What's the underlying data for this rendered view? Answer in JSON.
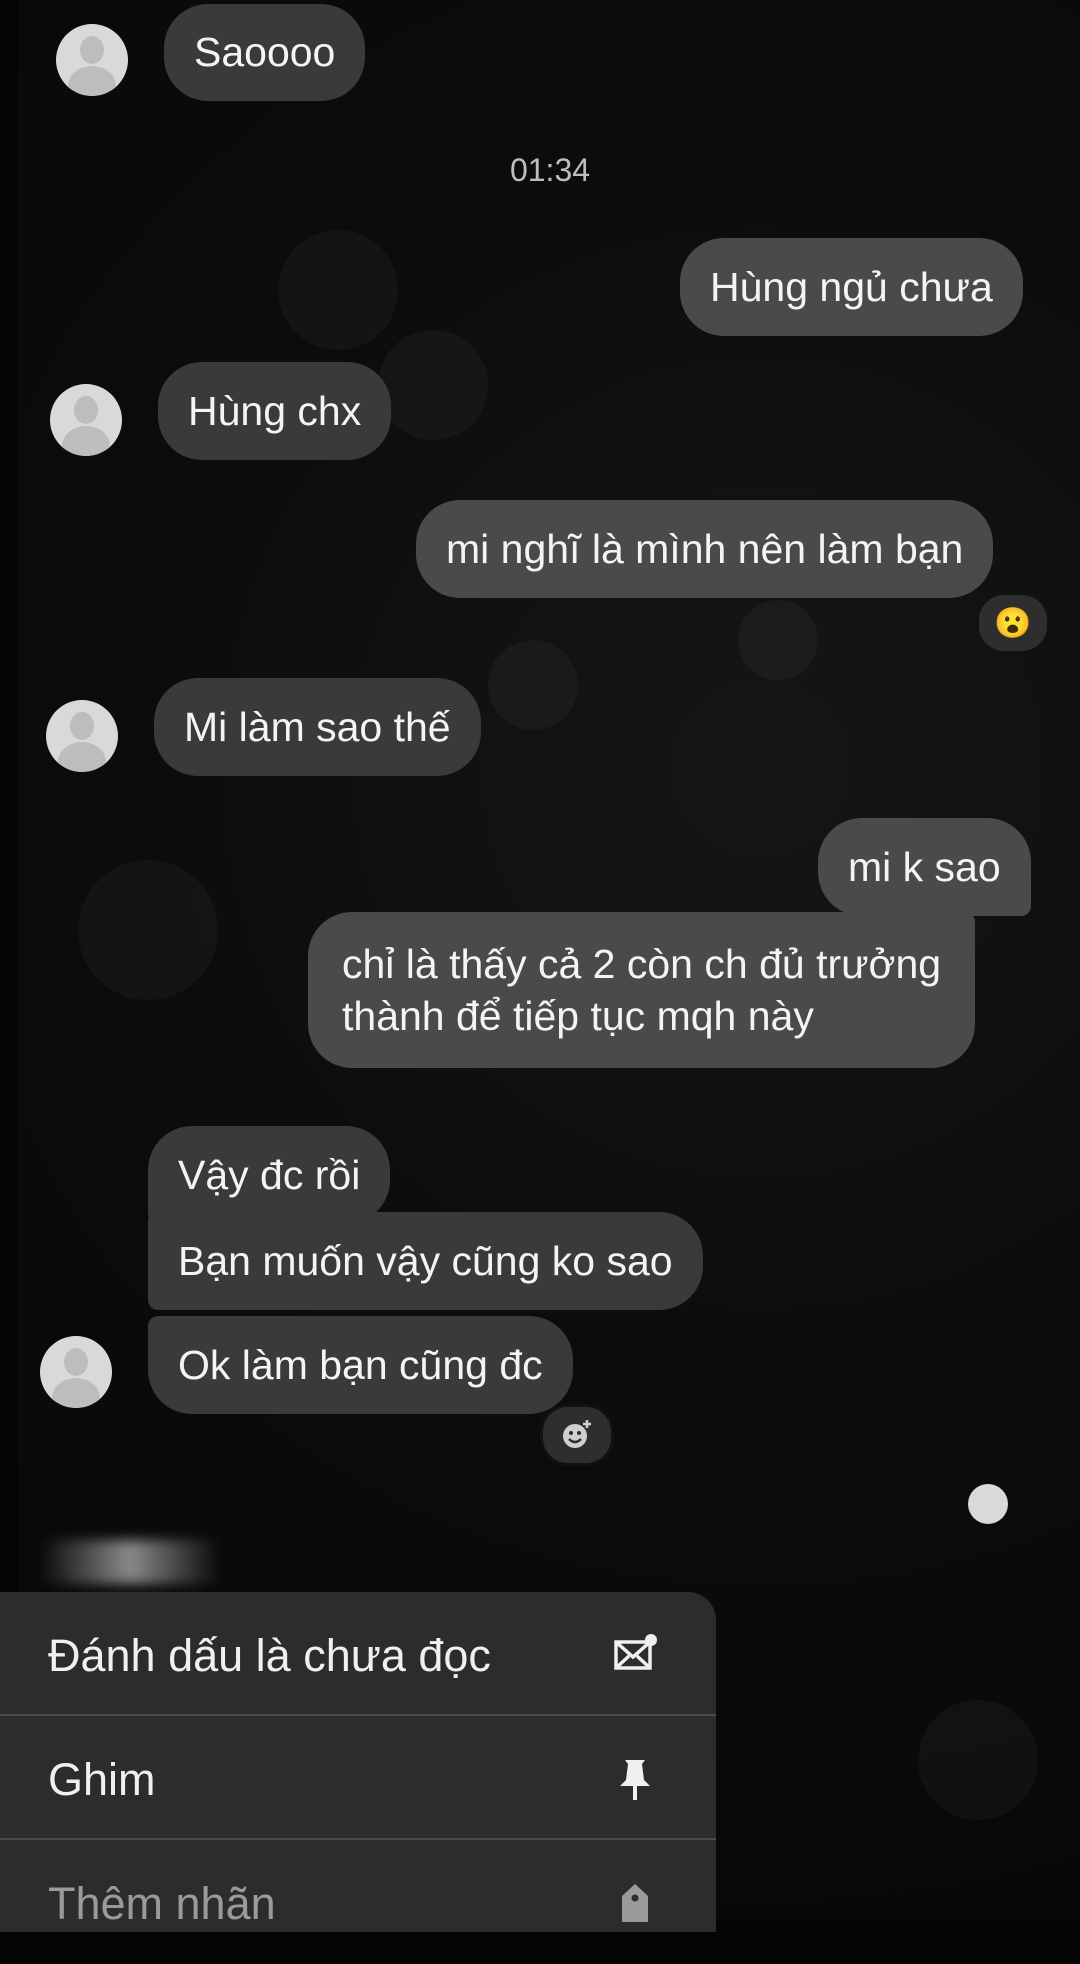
{
  "chat": {
    "time_divider": "01:34",
    "messages": [
      {
        "dir": "in",
        "text": "Saoooo"
      },
      {
        "dir": "out",
        "text": "Hùng ngủ chưa"
      },
      {
        "dir": "in",
        "text": "Hùng chx"
      },
      {
        "dir": "out",
        "text": "mi nghĩ là mình nên làm bạn",
        "reaction": "😮"
      },
      {
        "dir": "in",
        "text": "Mi làm sao thế"
      },
      {
        "dir": "out",
        "text": "mi k sao"
      },
      {
        "dir": "out",
        "lines": [
          "chỉ là thấy cả 2 còn ch đủ trưởng",
          "thành để tiếp tục mqh này"
        ]
      },
      {
        "dir": "in",
        "text": "Vậy đc rồi"
      },
      {
        "dir": "in",
        "text": "Bạn muốn vậy cũng ko sao"
      },
      {
        "dir": "in",
        "text": "Ok làm bạn cũng đc",
        "reaction": "add-reaction-icon"
      }
    ]
  },
  "context_menu": {
    "items": [
      {
        "label": "Đánh dấu là chưa đọc",
        "icon": "mark-unread-icon"
      },
      {
        "label": "Ghim",
        "icon": "pin-icon"
      },
      {
        "label": "Thêm nhãn",
        "icon": "tag-icon"
      }
    ]
  }
}
